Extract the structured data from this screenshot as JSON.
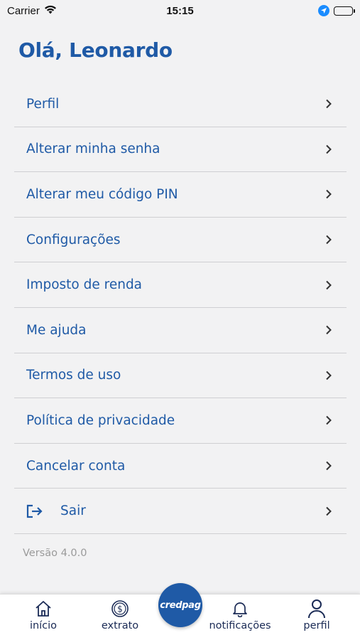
{
  "status_bar": {
    "carrier": "Carrier",
    "time": "15:15"
  },
  "header": {
    "greeting": "Olá, Leonardo"
  },
  "menu": {
    "items": [
      {
        "label": "Perfil"
      },
      {
        "label": "Alterar minha senha"
      },
      {
        "label": "Alterar meu código PIN"
      },
      {
        "label": "Configurações"
      },
      {
        "label": "Imposto de renda"
      },
      {
        "label": "Me ajuda"
      },
      {
        "label": "Termos de uso"
      },
      {
        "label": "Política de privacidade"
      },
      {
        "label": "Cancelar conta"
      }
    ],
    "logout_label": "Sair"
  },
  "version": "Versão 4.0.0",
  "tab_bar": {
    "tabs": [
      {
        "label": "início",
        "icon": "home-icon"
      },
      {
        "label": "extrato",
        "icon": "dollar-coin-icon"
      },
      {
        "label": "notificações",
        "icon": "bell-icon"
      },
      {
        "label": "perfil",
        "icon": "user-icon"
      }
    ],
    "center_button": "credpag"
  },
  "colors": {
    "primary": "#1f5aa6",
    "background": "#f2f2f3",
    "divider": "#cfcfd2",
    "muted": "#9a9a9a",
    "tab_text": "#1a2a55"
  }
}
